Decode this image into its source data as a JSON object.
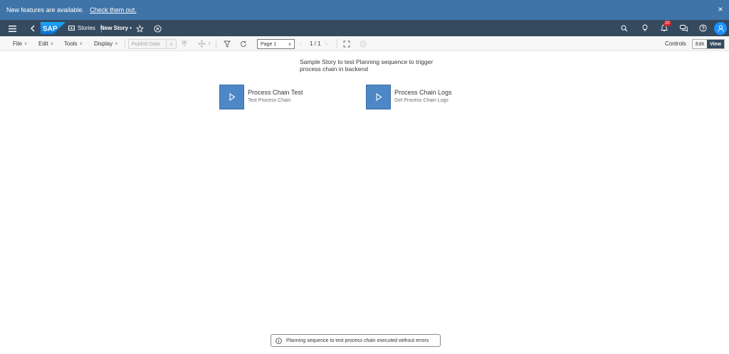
{
  "banner": {
    "message": "New features are available.",
    "link": "Check them out.",
    "close": "×"
  },
  "shell": {
    "brand": "SAP",
    "stories_label": "Stories",
    "story_name": "New Story",
    "story_modified": "•",
    "notification_count": "20"
  },
  "toolbar": {
    "file": "File",
    "edit": "Edit",
    "tools": "Tools",
    "display": "Display",
    "publish_data": "Publish Data",
    "page_select": "Page 1",
    "page_count": "1 / 1",
    "controls": "Controls",
    "mode_edit": "Edit",
    "mode_view": "View"
  },
  "content": {
    "description": "Sample Story to test Planning sequence to trigger process chain in backend",
    "tiles": [
      {
        "title": "Process Chain Test",
        "subtitle": "Test Process Chain"
      },
      {
        "title": "Process Chain Logs",
        "subtitle": "Get Process Chain Logs"
      }
    ]
  },
  "toast": {
    "message": "Planning sequence to test process chain executed without errors"
  },
  "colors": {
    "banner": "#3f74a8",
    "shell": "#354a5f",
    "tile": "#4d87c6",
    "badge": "#d0262a",
    "avatar": "#1b90ff"
  }
}
